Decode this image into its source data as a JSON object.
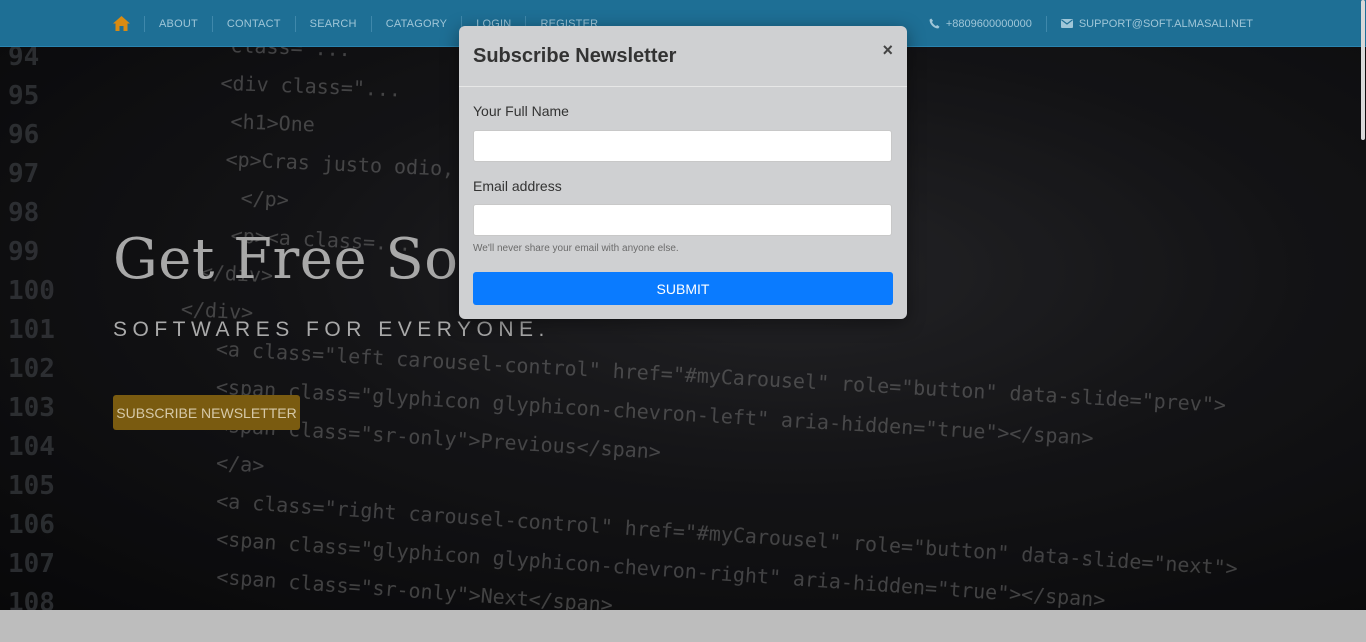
{
  "nav": {
    "items": [
      {
        "label": "ABOUT"
      },
      {
        "label": "CONTACT"
      },
      {
        "label": "SEARCH"
      },
      {
        "label": "CATAGORY"
      },
      {
        "label": "LOGIN"
      },
      {
        "label": "REGISTER"
      }
    ],
    "phone": "+8809600000000",
    "email": "SUPPORT@SOFT.ALMASALI.NET"
  },
  "hero": {
    "title": "Get Free Software",
    "tagline": "SOFTWARES FOR EVERYONE.",
    "button_label": "SUBSCRIBE NEWSLETTER",
    "code_lines": [
      {
        "num": "94",
        "code": "class=\"..."
      },
      {
        "num": "95",
        "code": "<div class=\"..."
      },
      {
        "num": "96",
        "code": "<h1>One"
      },
      {
        "num": "97",
        "code": "<p>Cras justo odio, dapibus ac..."
      },
      {
        "num": "98",
        "code": "</p>"
      },
      {
        "num": "99",
        "code": "<p><a class=..."
      },
      {
        "num": "100",
        "code": "</div>"
      },
      {
        "num": "101",
        "code": "</div>"
      },
      {
        "num": "102",
        "code": "<a class=\"left carousel-control\" href=\"#myCarousel\" role=\"button\" data-slide=\"prev\">"
      },
      {
        "num": "103",
        "code": "  <span class=\"glyphicon glyphicon-chevron-left\" aria-hidden=\"true\"></span>"
      },
      {
        "num": "104",
        "code": "  <span class=\"sr-only\">Previous</span>"
      },
      {
        "num": "105",
        "code": "</a>"
      },
      {
        "num": "106",
        "code": "<a class=\"right carousel-control\" href=\"#myCarousel\" role=\"button\" data-slide=\"next\">"
      },
      {
        "num": "107",
        "code": "  <span class=\"glyphicon glyphicon-chevron-right\" aria-hidden=\"true\"></span>"
      },
      {
        "num": "108",
        "code": "  <span class=\"sr-only\">Next</span>"
      }
    ]
  },
  "modal": {
    "title": "Subscribe Newsletter",
    "close": "×",
    "name_label": "Your Full Name",
    "name_value": "",
    "email_label": "Email address",
    "email_value": "",
    "email_help": "We'll never share your email with anyone else.",
    "submit_label": "SUBMIT"
  },
  "colors": {
    "topbar": "#1e6f95",
    "home_icon": "#d98b12",
    "hero_button": "#7a5b10",
    "submit_button": "#0a7bff"
  }
}
